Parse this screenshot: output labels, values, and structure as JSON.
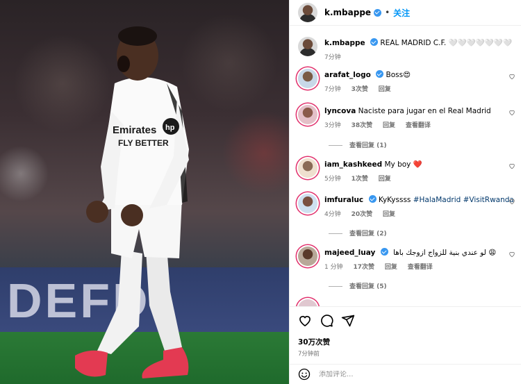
{
  "post": {
    "author": "k.mbappe",
    "follow_label": "关注",
    "dot": "•",
    "caption": "REAL MADRID C.F. 🤍🤍🤍🤍🤍🤍🤍",
    "caption_time": "7分钟",
    "photo_ad_text": "DEFD",
    "likes": "30万次赞",
    "posted_time": "7分钟前"
  },
  "comments": [
    {
      "user": "arafat_logo",
      "verified": true,
      "text": "Boss😍",
      "time": "7分钟",
      "likes": "3次赞",
      "reply": "回复",
      "translate": "",
      "view_replies": ""
    },
    {
      "user": "lyncova",
      "verified": false,
      "text": "Naciste para jugar en el Real Madrid",
      "time": "3分钟",
      "likes": "38次赞",
      "reply": "回复",
      "translate": "查看翻译",
      "view_replies": "查看回复 (1)"
    },
    {
      "user": "iam_kashkeed",
      "verified": false,
      "text": "My boy ❤️",
      "time": "5分钟",
      "likes": "1次赞",
      "reply": "回复",
      "translate": "",
      "view_replies": ""
    },
    {
      "user": "imfuraluc",
      "verified": true,
      "text_plain": "KyKyssss ",
      "tags": "#HalaMadrid #VisitRwanda",
      "text_end": " 🔥",
      "time": "4分钟",
      "likes": "20次赞",
      "reply": "回复",
      "translate": "",
      "view_replies": "查看回复 (2)"
    },
    {
      "user": "majeed_luay",
      "verified": true,
      "text": "😩 لو عندي بنية للزواج ازوجك باها",
      "time": "1 分钟",
      "likes": "17次赞",
      "reply": "回复",
      "translate": "查看翻译",
      "view_replies": "查看回复 (5)"
    }
  ],
  "input": {
    "placeholder": "添加评论..."
  },
  "icons": {
    "like": "heart-outline-icon",
    "comment": "speech-bubble-icon",
    "share": "paper-plane-icon",
    "emoji": "smiley-face-icon",
    "verified": "verified-badge-icon"
  },
  "colors": {
    "verified": "#3897f0",
    "follow": "#0095f6",
    "tag": "#00376b",
    "muted": "#737373",
    "red_heart": "#ed4956"
  }
}
